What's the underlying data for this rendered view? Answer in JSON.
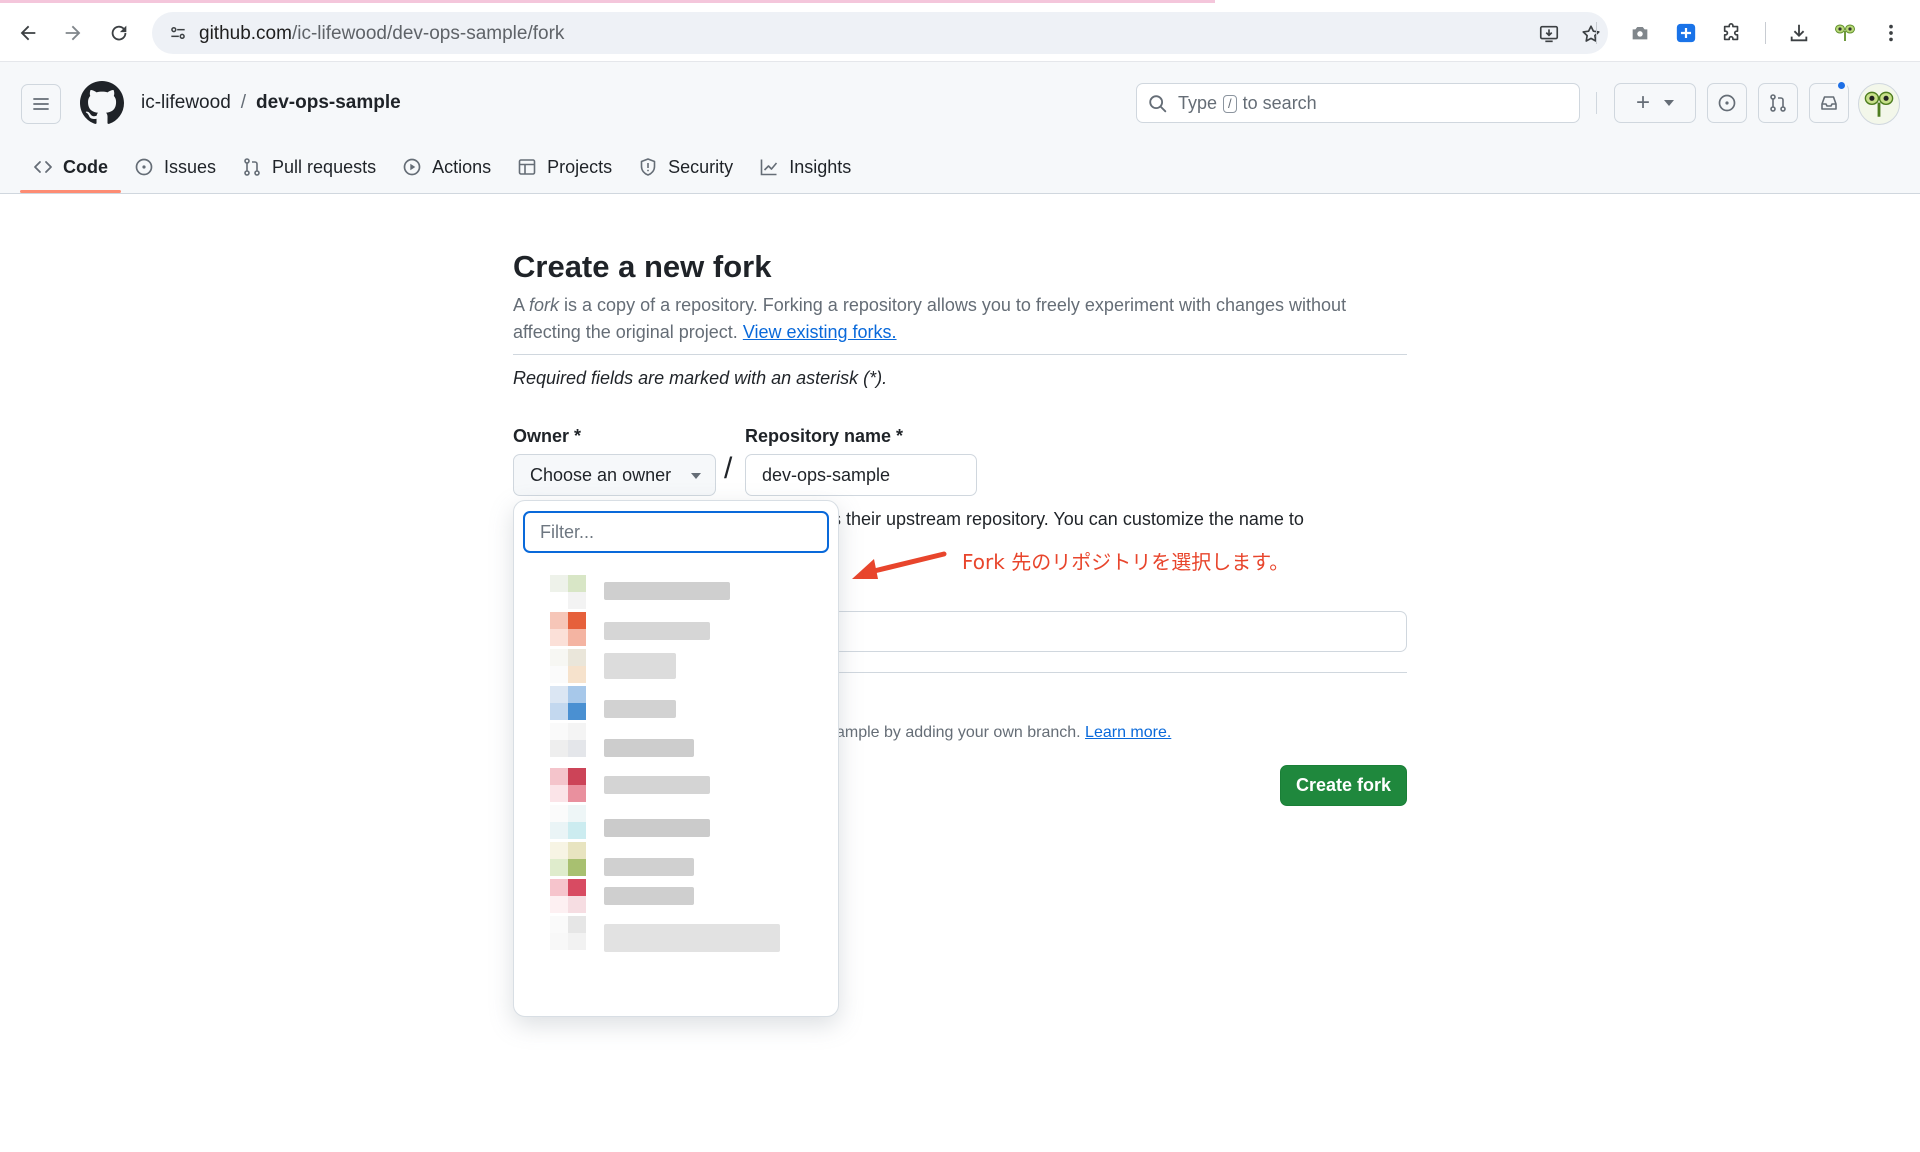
{
  "browser": {
    "url_host": "github.com",
    "url_path": "/ic-lifewood/dev-ops-sample/fork"
  },
  "header": {
    "owner": "ic-lifewood",
    "separator": "/",
    "repo": "dev-ops-sample",
    "search_prefix": "Type",
    "search_key": "/",
    "search_suffix": "to search",
    "new_button": "+"
  },
  "tabs": [
    {
      "label": "Code",
      "icon": "code-icon",
      "active": true
    },
    {
      "label": "Issues",
      "icon": "issue-icon"
    },
    {
      "label": "Pull requests",
      "icon": "pull-request-icon"
    },
    {
      "label": "Actions",
      "icon": "play-icon"
    },
    {
      "label": "Projects",
      "icon": "table-icon"
    },
    {
      "label": "Security",
      "icon": "shield-icon"
    },
    {
      "label": "Insights",
      "icon": "graph-icon"
    }
  ],
  "main": {
    "title": "Create a new fork",
    "intro_a": "A ",
    "intro_fork": "fork",
    "intro_b": " is a copy of a repository. Forking a repository allows you to freely experiment with changes without affecting the original project. ",
    "view_forks": "View existing forks.",
    "required_note": "Required fields are marked with an asterisk (*).",
    "owner_label": "Owner *",
    "owner_button": "Choose an owner",
    "slash": "/",
    "repo_label": "Repository name *",
    "repo_value": "dev-ops-sample",
    "partial_note": "s their upstream repository. You can customize the name to",
    "copy_note": "ample by adding your own branch.",
    "learn_more": "Learn more.",
    "create_button": "Create fork"
  },
  "annotation": {
    "text": "Fork 先のリポジトリを選択します。",
    "color": "#e8452c"
  },
  "dropdown": {
    "filter_placeholder": "Filter..."
  },
  "colors": {
    "primary_button": "#1f883d",
    "link": "#0969da",
    "tab_underline": "#fd8c73",
    "focus": "#0969da"
  }
}
